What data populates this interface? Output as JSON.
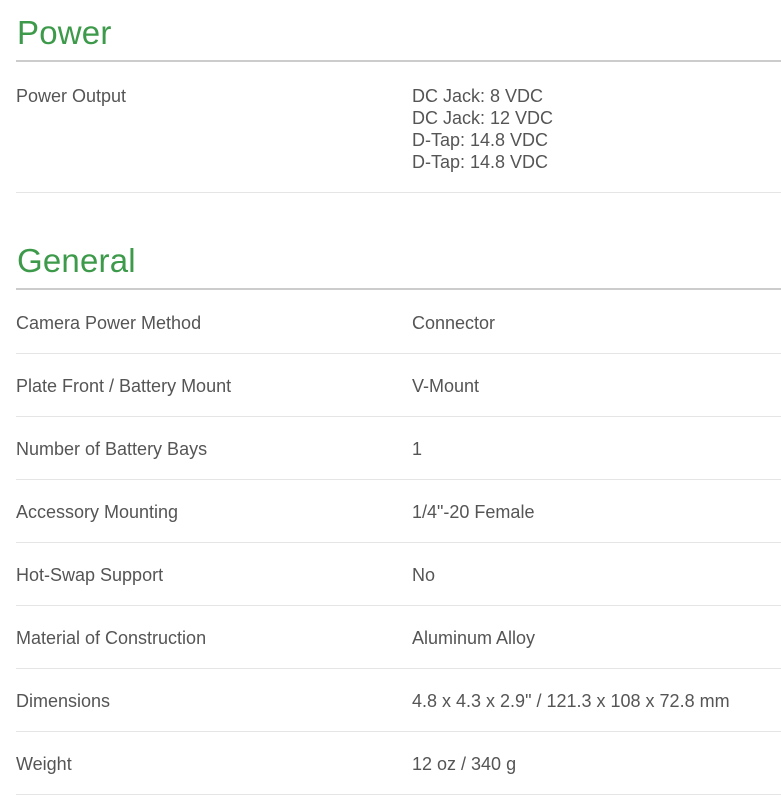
{
  "power": {
    "title": "Power",
    "rows": [
      {
        "label": "Power Output",
        "values": [
          "DC Jack: 8 VDC",
          "DC Jack: 12 VDC",
          "D-Tap: 14.8 VDC",
          "D-Tap: 14.8 VDC"
        ]
      }
    ]
  },
  "general": {
    "title": "General",
    "rows": [
      {
        "label": "Camera Power Method",
        "value": "Connector"
      },
      {
        "label": "Plate Front / Battery Mount",
        "value": "V-Mount"
      },
      {
        "label": "Number of Battery Bays",
        "value": "1"
      },
      {
        "label": "Accessory Mounting",
        "value": "1/4\"-20 Female"
      },
      {
        "label": "Hot-Swap Support",
        "value": "No"
      },
      {
        "label": "Material of Construction",
        "value": "Aluminum Alloy"
      },
      {
        "label": "Dimensions",
        "value": "4.8 x 4.3 x 2.9\" / 121.3 x 108 x 72.8 mm"
      },
      {
        "label": "Weight",
        "value": "12 oz / 340 g"
      }
    ]
  },
  "colors": {
    "heading": "#3d9a4a",
    "text": "#555555",
    "divider": "#e5e5e5",
    "heading_rule": "#cccccc"
  }
}
